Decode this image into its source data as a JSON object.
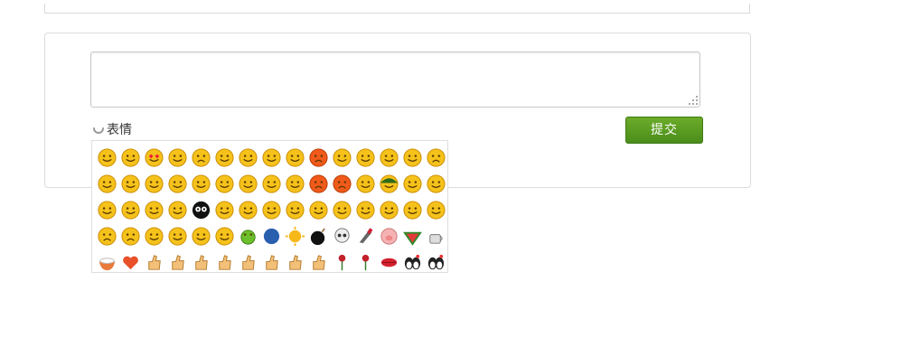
{
  "comment": {
    "textarea_value": "",
    "emoji_label": "表情",
    "submit_label": "提交"
  },
  "emoji_grid": {
    "rows": [
      [
        "smile",
        "frown",
        "heart-eyes",
        "grin",
        "crying",
        "shy",
        "zip-mouth",
        "sleepy",
        "sweat",
        "angry",
        "tongue-out",
        "grin-wide",
        "surprised",
        "thinking",
        "sad"
      ],
      [
        "cool",
        "embarrassed",
        "laugh-tears",
        "laugh-hand",
        "chuckle",
        "yawn",
        "greedy",
        "sleeping",
        "drooling",
        "mad",
        "frustrated",
        "sweat-smile",
        "soldier",
        "cheeky",
        "shocked"
      ],
      [
        "dizzy",
        "shh",
        "confused",
        "angry-steam",
        "skeleton-face",
        "wave",
        "ponder",
        "hmm",
        "curse",
        "poke",
        "knock",
        "awkward",
        "pig-snout",
        "pouting",
        "yelling"
      ],
      [
        "bored",
        "sick",
        "scared",
        "kiss-blow",
        "crazy",
        "stuttering",
        "green-frog",
        "moon",
        "sun",
        "bomb",
        "skull",
        "knife",
        "pig",
        "watermelon",
        "coffee"
      ],
      [
        "rice-bowl",
        "heart",
        "thumbs-up",
        "thumbs-down",
        "handshake",
        "victory",
        "fist-hug",
        "hand-hook",
        "ok-hand",
        "peace-hand",
        "rose",
        "wilted-rose",
        "lips",
        "penguin-couple",
        "penguin-kiss"
      ]
    ]
  },
  "colors": {
    "submit_bg": "#5c9e22",
    "emoji_face": "#f5c21b",
    "emoji_outline": "#c98a00"
  }
}
